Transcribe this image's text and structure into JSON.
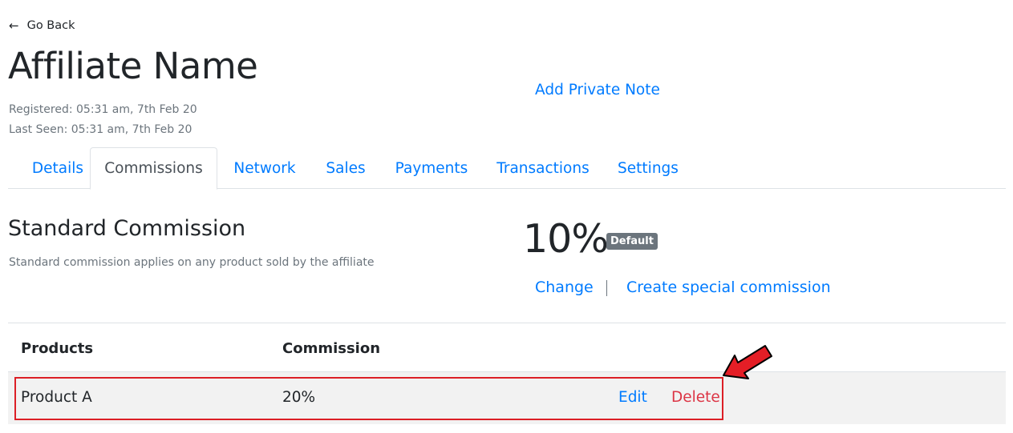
{
  "nav": {
    "go_back_label": "Go Back",
    "back_icon": "←"
  },
  "header": {
    "title": "Affiliate Name",
    "registered": "Registered: 05:31 am, 7th Feb 20",
    "last_seen": "Last Seen: 05:31 am, 7th Feb 20",
    "add_note_label": "Add Private Note"
  },
  "tabs": [
    {
      "label": "Details"
    },
    {
      "label": "Commissions",
      "active": true
    },
    {
      "label": "Network"
    },
    {
      "label": "Sales"
    },
    {
      "label": "Payments"
    },
    {
      "label": "Transactions"
    },
    {
      "label": "Settings"
    }
  ],
  "standard": {
    "title": "Standard Commission",
    "description": "Standard commission applies on any product sold by the affiliate",
    "rate": "10%",
    "badge": "Default",
    "change_label": "Change",
    "create_label": "Create special commission"
  },
  "table": {
    "columns": [
      "Products",
      "Commission"
    ],
    "rows": [
      {
        "product": "Product A",
        "commission": "20%",
        "edit_label": "Edit",
        "delete_label": "Delete"
      }
    ]
  },
  "colors": {
    "link": "#007bff",
    "danger": "#dc3545",
    "muted": "#6c757d",
    "annotation": "#e41e26"
  }
}
